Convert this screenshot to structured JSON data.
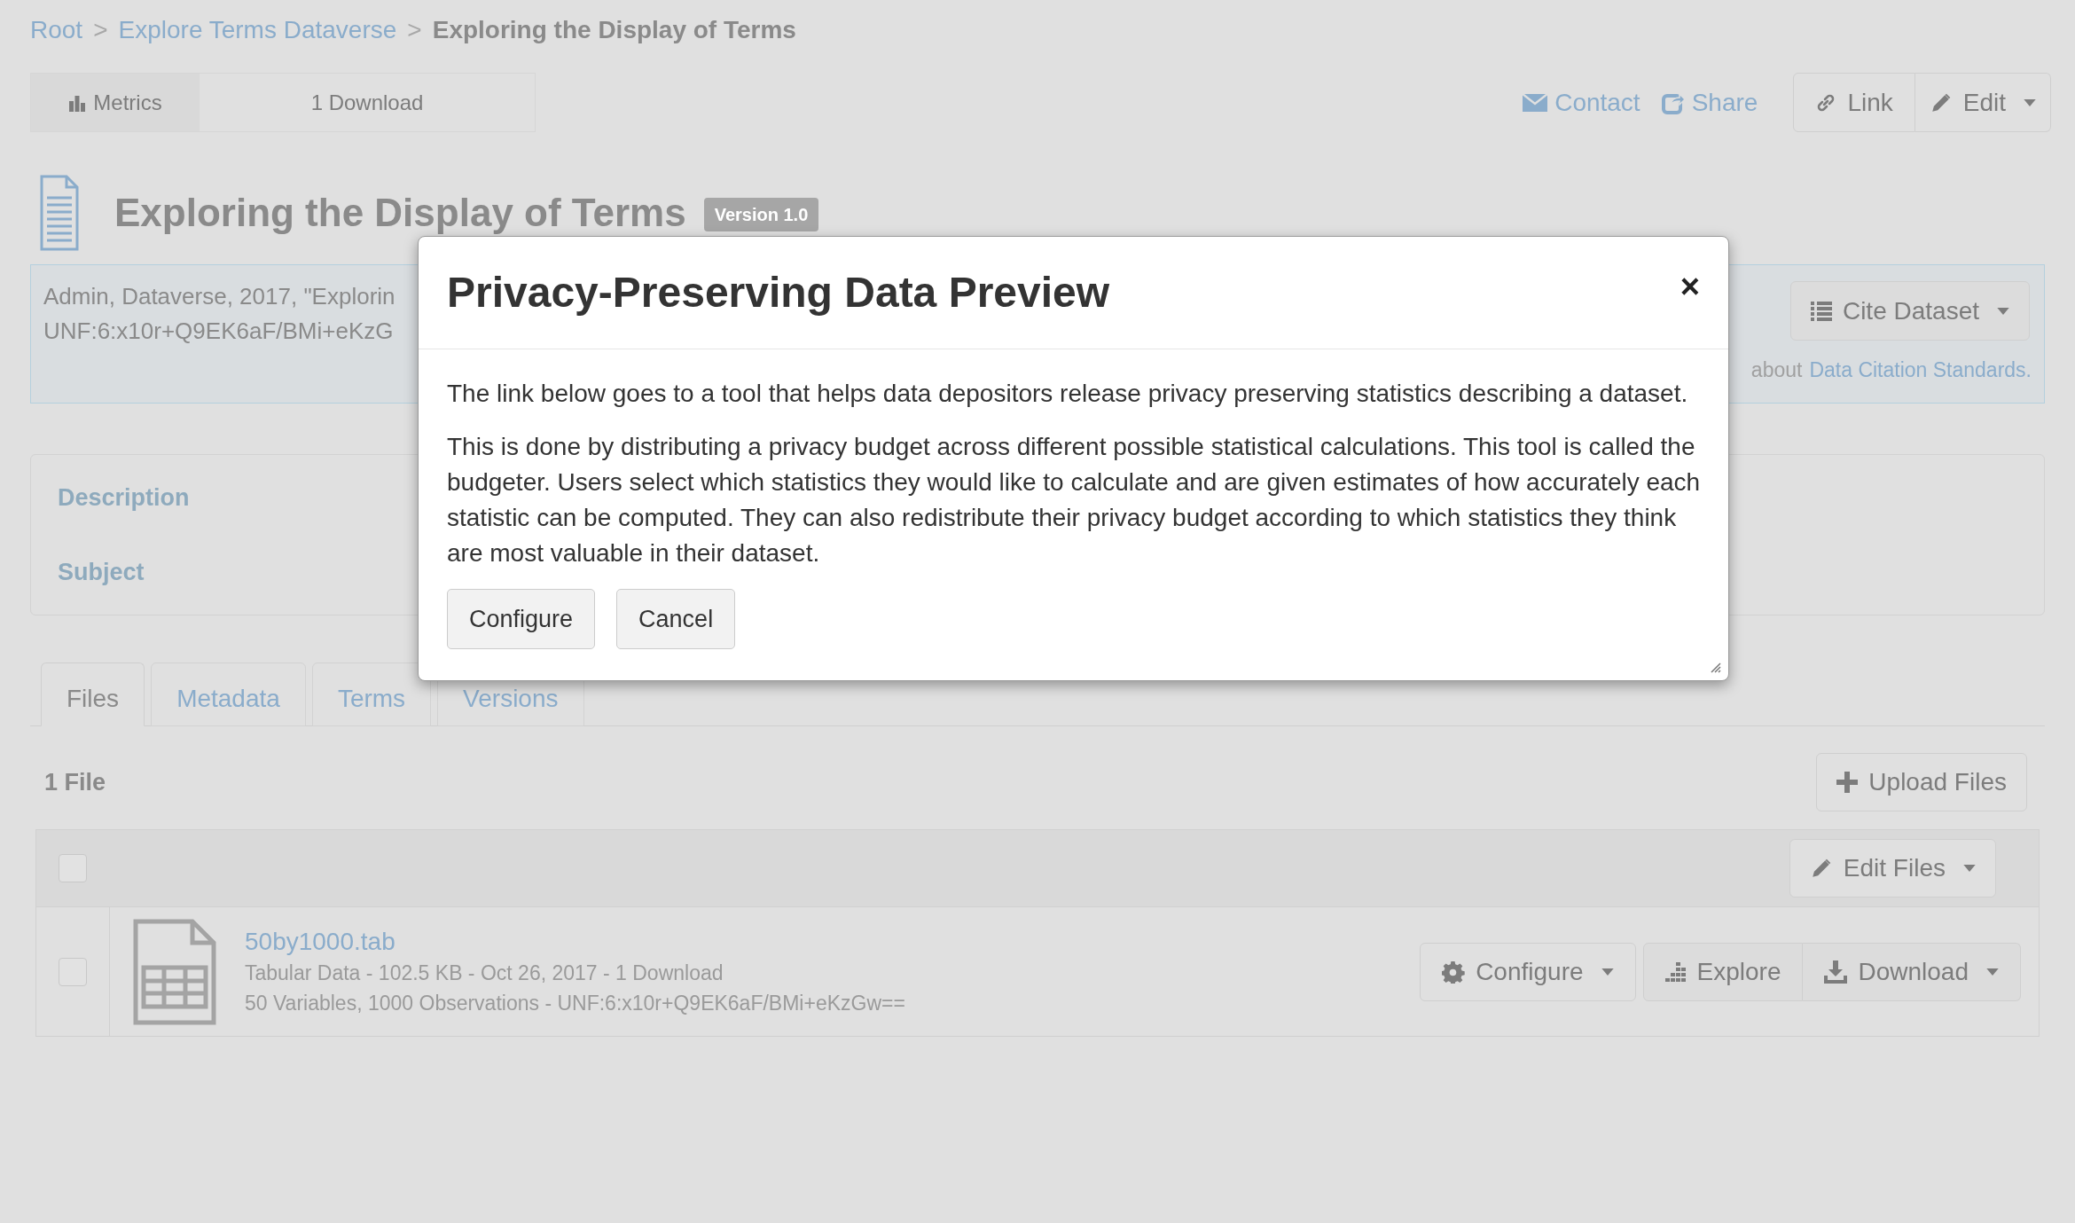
{
  "breadcrumb": [
    {
      "label": "Root",
      "kind": "link"
    },
    {
      "label": "Explore Terms Dataverse",
      "kind": "link"
    },
    {
      "label": "Exploring the Display of Terms",
      "kind": "current"
    }
  ],
  "breadcrumb_separator": ">",
  "metrics": {
    "label": "Metrics",
    "downloads": "1 Download"
  },
  "actions": {
    "contact": "Contact",
    "share": "Share",
    "link": "Link",
    "edit": "Edit"
  },
  "dataset": {
    "title": "Exploring the Display of Terms",
    "version": "Version 1.0"
  },
  "citation": {
    "lines": [
      "Admin, Dataverse, 2017, \"Explorin",
      "UNF:6:x10r+Q9EK6aF/BMi+eKzG"
    ],
    "cite_button": "Cite Dataset",
    "note": "about",
    "note_link": "Data Citation Standards."
  },
  "summary": {
    "fields": [
      "Description",
      "Subject"
    ]
  },
  "tabs": [
    {
      "label": "Files",
      "selected": true
    },
    {
      "label": "Metadata",
      "selected": false
    },
    {
      "label": "Terms",
      "selected": false
    },
    {
      "label": "Versions",
      "selected": false
    }
  ],
  "files": {
    "count": "1 File",
    "upload_button": "Upload Files",
    "edit_files_button": "Edit Files",
    "select_all_checked": false,
    "rows": [
      {
        "name": "50by1000.tab",
        "meta": "Tabular Data - 102.5 KB - Oct 26, 2017 - 1 Download",
        "details": "50 Variables, 1000 Observations - UNF:6:x10r+Q9EK6aF/BMi+eKzGw==",
        "checked": false,
        "configure": "Configure",
        "explore": "Explore",
        "download": "Download"
      }
    ]
  },
  "modal": {
    "title": "Privacy-Preserving Data Preview",
    "close": "×",
    "paragraphs": [
      "The link below goes to a tool that helps data depositors release privacy preserving statistics describing a dataset.",
      "This is done by distributing a privacy budget across different possible statistical calculations. This tool is called the budgeter. Users select which statistics they would like to calculate and are given estimates of how accurately each statistic can be computed. They can also redistribute their privacy budget according to which statistics they think are most valuable in their dataset."
    ],
    "buttons": [
      "Configure",
      "Cancel"
    ]
  }
}
